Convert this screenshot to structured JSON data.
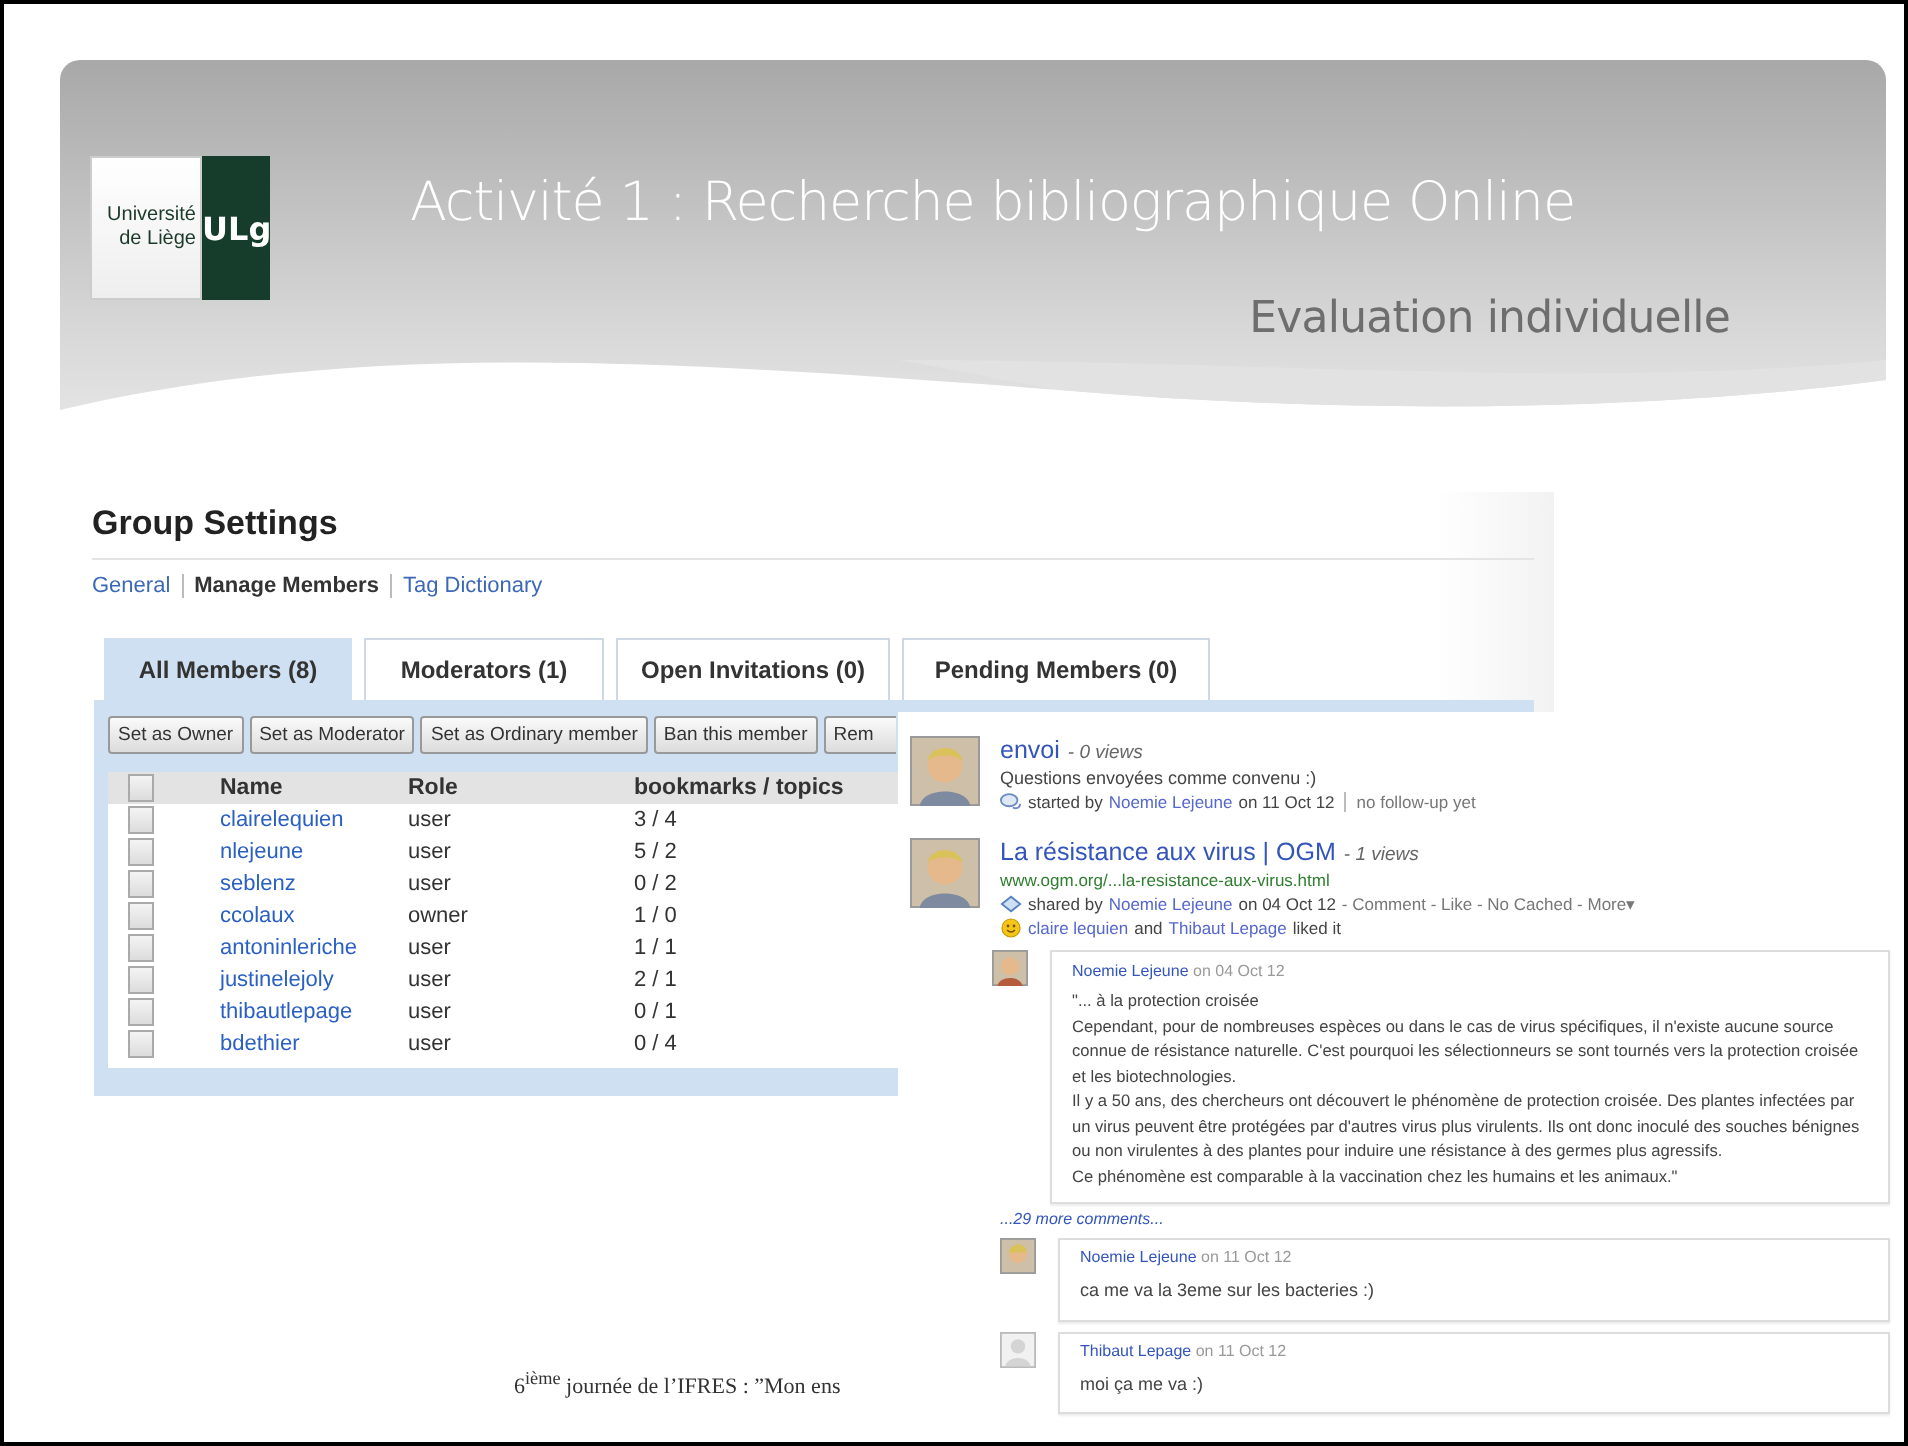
{
  "slide": {
    "title": "Activité 1 : Recherche bibliographique Online",
    "subtitle": "Evaluation individuelle",
    "logo": {
      "lines": [
        "Université",
        "de Liège"
      ],
      "mark": "ULg"
    },
    "footer": "6$^{ième}$ journée de l’IFRES : ”Mon ens"
  },
  "group_settings": {
    "title": "Group Settings",
    "nav": [
      {
        "label": "General",
        "selected": false
      },
      {
        "label": "Manage Members",
        "selected": true
      },
      {
        "label": "Tag Dictionary",
        "selected": false
      }
    ],
    "tabs": [
      {
        "label": "All Members (8)",
        "selected": true
      },
      {
        "label": "Moderators (1)",
        "selected": false
      },
      {
        "label": "Open Invitations (0)",
        "selected": false
      },
      {
        "label": "Pending Members (0)",
        "selected": false
      }
    ],
    "buttons": [
      "Set as Owner",
      "Set as Moderator",
      "Set as Ordinary member",
      "Ban this member",
      "Rem"
    ],
    "table": {
      "header_checked": false,
      "columns": [
        "Name",
        "Role",
        "bookmarks / topics"
      ],
      "rows": [
        {
          "name": "clairelequien",
          "role": "user",
          "counts": "3 / 4",
          "checked": false
        },
        {
          "name": "nlejeune",
          "role": "user",
          "counts": "5 / 2",
          "checked": false
        },
        {
          "name": "seblenz",
          "role": "user",
          "counts": "0 / 2",
          "checked": false
        },
        {
          "name": "ccolaux",
          "role": "owner",
          "counts": "1 / 0",
          "checked": false
        },
        {
          "name": "antoninleriche",
          "role": "user",
          "counts": "1 / 1",
          "checked": false
        },
        {
          "name": "justinelejoly",
          "role": "user",
          "counts": "2 / 1",
          "checked": false
        },
        {
          "name": "thibautlepage",
          "role": "user",
          "counts": "0 / 1",
          "checked": false
        },
        {
          "name": "bdethier",
          "role": "user",
          "counts": "0 / 4",
          "checked": false
        }
      ]
    }
  },
  "feed": {
    "posts": [
      {
        "kind": "discussion",
        "title": "envoi",
        "views": "- 0 views",
        "description": "Questions envoyées comme convenu :)",
        "meta_prefix": "started by",
        "author": "Noemie Lejeune",
        "date": "on 11 Oct 12",
        "meta_extra": "no follow-up yet"
      },
      {
        "kind": "link",
        "title": "La résistance aux virus | OGM",
        "views": "- 1 views",
        "url": "www.ogm.org/...la-resistance-aux-virus.html",
        "meta_prefix": "shared by",
        "author": "Noemie Lejeune",
        "date": "on 04 Oct 12",
        "meta_extra": "- Comment - Like - No Cached - More▾",
        "likes": {
          "names": [
            "claire lequien",
            "Thibaut Lepage"
          ],
          "joiner": "and",
          "suffix": "liked it"
        },
        "comments": [
          {
            "kind": "photo",
            "author": "Noemie Lejeune",
            "date": "on 04 Oct 12",
            "text": "\"... à la protection croisée\nCependant, pour de nombreuses  espèces ou dans le cas de virus spécifiques, il n'existe aucune source connue de résistance naturelle. C'est pourquoi les sélectionneurs se sont tournés vers la protection croisée et les biotechnologies.\nIl y a 50 ans, des chercheurs ont découvert le phénomène de protection croisée. Des plantes infectées par un virus peuvent être protégées par d'autres virus plus virulents. Ils ont donc inoculé des souches bénignes ou non virulentes à des plantes pour induire une résistance à des germes plus agressifs.\nCe phénomène est comparable à la vaccination chez les humains et les animaux.\""
          }
        ],
        "more_comments": "...29 more comments...",
        "later_comments": [
          {
            "kind": "photo",
            "author": "Noemie Lejeune",
            "date": "on 11 Oct 12",
            "text": "ca me va la 3eme sur les bacteries :)"
          },
          {
            "kind": "blank",
            "author": "Thibaut Lepage",
            "date": "on 11 Oct 12",
            "text": "moi ça me va :)"
          }
        ]
      }
    ]
  }
}
